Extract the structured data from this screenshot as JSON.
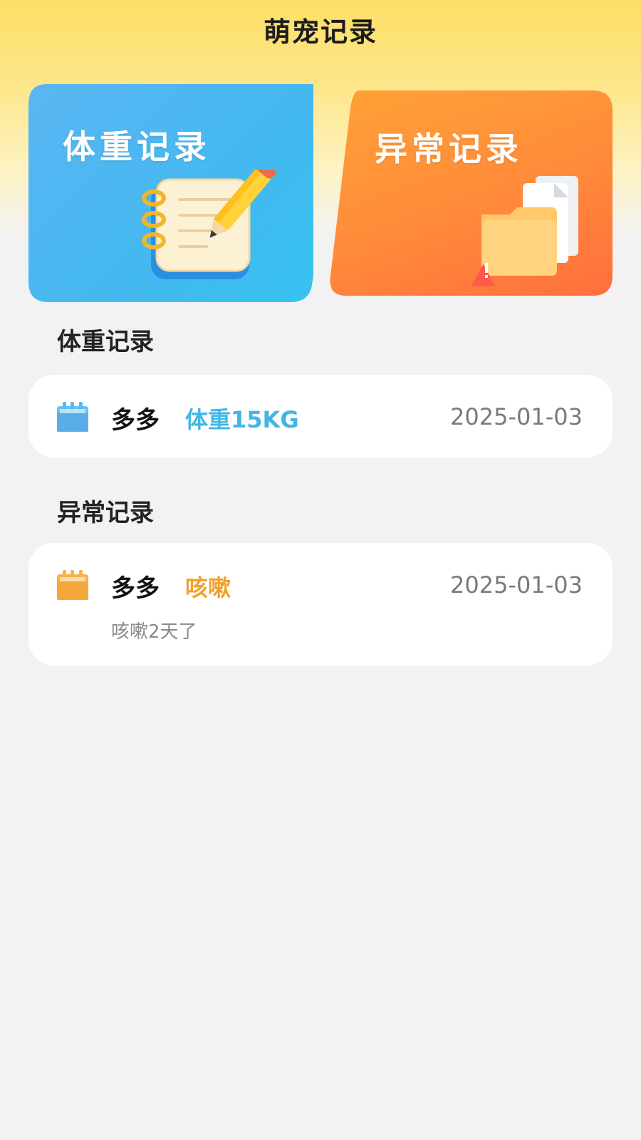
{
  "header": {
    "title": "萌宠记录"
  },
  "cards": [
    {
      "label": "体重记录",
      "icon": "notebook-pencil-icon"
    },
    {
      "label": "异常记录",
      "icon": "folder-warning-icon"
    }
  ],
  "weight_section": {
    "title": "体重记录",
    "records": [
      {
        "pet": "多多",
        "tag": "体重15KG",
        "date": "2025-01-03",
        "icon": "calendar-icon",
        "accent": "#41b6e6"
      }
    ]
  },
  "abnormal_section": {
    "title": "异常记录",
    "records": [
      {
        "pet": "多多",
        "tag": "咳嗽",
        "date": "2025-01-03",
        "note": "咳嗽2天了",
        "icon": "calendar-icon",
        "accent": "#f0a030"
      }
    ]
  }
}
